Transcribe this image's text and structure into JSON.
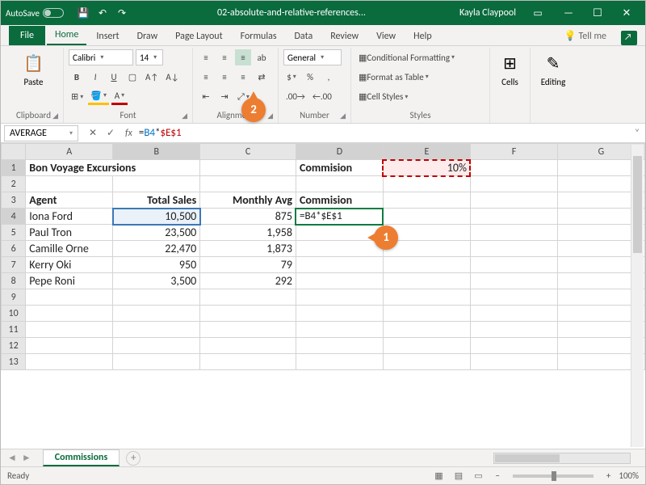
{
  "titlebar": {
    "autosave": "AutoSave",
    "filename": "02-absolute-and-relative-references...",
    "user": "Kayla Claypool"
  },
  "tabs": {
    "file": "File",
    "home": "Home",
    "insert": "Insert",
    "draw": "Draw",
    "page": "Page Layout",
    "formulas": "Formulas",
    "data": "Data",
    "review": "Review",
    "view": "View",
    "help": "Help",
    "tellme": "Tell me"
  },
  "ribbon": {
    "clipboard": {
      "label": "Clipboard",
      "paste": "Paste"
    },
    "font": {
      "label": "Font",
      "name": "Calibri",
      "size": "14"
    },
    "alignment": {
      "label": "Alignment"
    },
    "number": {
      "label": "Number",
      "format": "General"
    },
    "styles": {
      "label": "Styles",
      "cond": "Conditional Formatting",
      "table": "Format as Table",
      "cell": "Cell Styles"
    },
    "cells": {
      "label": "Cells"
    },
    "editing": {
      "label": "Editing"
    }
  },
  "namebox": "AVERAGE",
  "formula": {
    "full": "=B4*$E$1",
    "part1": "=",
    "ref1": "B4",
    "op": "*",
    "ref2": "$E$1"
  },
  "cols": [
    "A",
    "B",
    "C",
    "D",
    "E",
    "F",
    "G"
  ],
  "sheet": {
    "a1": "Bon Voyage Excursions",
    "d1": "Commision",
    "e1": "10%",
    "a3": "Agent",
    "b3": "Total Sales",
    "c3": "Monthly Avg",
    "d3": "Commision",
    "rows": [
      {
        "a": "Iona Ford",
        "b": "10,500",
        "c": "875",
        "d": "=B4*$E$1"
      },
      {
        "a": "Paul Tron",
        "b": "23,500",
        "c": "1,958",
        "d": ""
      },
      {
        "a": "Camille Orne",
        "b": "22,470",
        "c": "1,873",
        "d": ""
      },
      {
        "a": "Kerry Oki",
        "b": "950",
        "c": "79",
        "d": ""
      },
      {
        "a": "Pepe Roni",
        "b": "3,500",
        "c": "292",
        "d": ""
      }
    ]
  },
  "sheet_tab": "Commissions",
  "status": {
    "ready": "Ready",
    "zoom": "100%"
  },
  "callouts": {
    "one": "1",
    "two": "2"
  }
}
